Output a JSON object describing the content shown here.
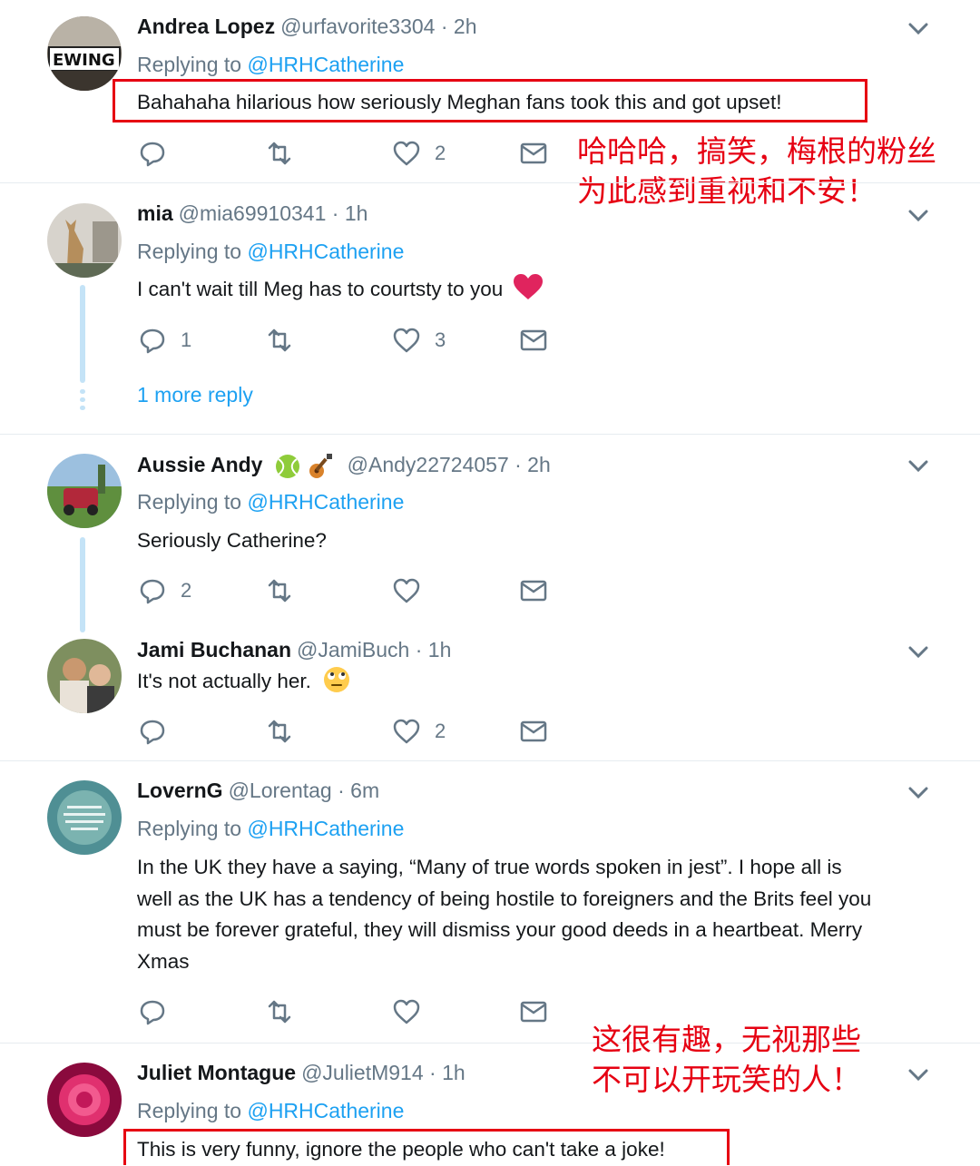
{
  "tweets": [
    {
      "name": "Andrea Lopez",
      "handle": "@urfavorite3304 · 2h",
      "replying_prefix": "Replying to",
      "replying_to": "@HRHCatherine",
      "text": "Bahahaha hilarious how seriously Meghan fans took this and got upset!",
      "reply_count": "",
      "retweet_count": "",
      "like_count": "2",
      "avatar_text": "EWING"
    },
    {
      "name": "mia",
      "handle": "@mia69910341 · 1h",
      "replying_prefix": "Replying to",
      "replying_to": "@HRHCatherine",
      "text": "I can't wait till Meg has to courtsty to you",
      "reply_count": "1",
      "retweet_count": "",
      "like_count": "3",
      "more_reply": "1 more reply"
    },
    {
      "name": "Aussie Andy",
      "handle": "@Andy22724057 · 2h",
      "replying_prefix": "Replying to",
      "replying_to": "@HRHCatherine",
      "text": "Seriously Catherine?",
      "reply_count": "2",
      "retweet_count": "",
      "like_count": ""
    },
    {
      "name": "Jami Buchanan",
      "handle": "@JamiBuch · 1h",
      "text": "It's not actually her.",
      "reply_count": "",
      "retweet_count": "",
      "like_count": "2"
    },
    {
      "name": "LovernG",
      "handle": "@Lorentag · 6m",
      "replying_prefix": "Replying to",
      "replying_to": "@HRHCatherine",
      "text_lines": [
        "In the UK they have a saying, “Many of true words spoken in jest”. I hope all is",
        "well as the UK has a tendency of being hostile to foreigners and the Brits feel you",
        "must be forever grateful, they will dismiss your good deeds in a heartbeat. Merry",
        "Xmas"
      ],
      "reply_count": "",
      "retweet_count": "",
      "like_count": ""
    },
    {
      "name": "Juliet Montague",
      "handle": "@JulietM914 · 1h",
      "replying_prefix": "Replying to",
      "replying_to": "@HRHCatherine",
      "text": "This is very funny, ignore the people who can't take a joke!"
    }
  ],
  "annotations": {
    "first": [
      "哈哈哈，搞笑，梅根的粉丝",
      "为此感到重视和不安！"
    ],
    "last": [
      "这很有趣，无视那些",
      "不可以开玩笑的人！"
    ]
  },
  "colors": {
    "accent": "#1da1f2",
    "muted": "#657786",
    "annotation_red": "#e60012",
    "heart_red": "#e0245e"
  }
}
